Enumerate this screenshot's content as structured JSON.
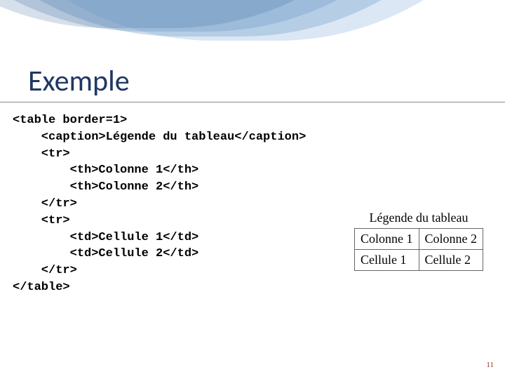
{
  "slide": {
    "title": "Exemple",
    "pageNumber": "11"
  },
  "code": {
    "line1": "<table border=1>",
    "line2": "    <caption>Légende du tableau</caption>",
    "line3": "    <tr>",
    "line4": "        <th>Colonne 1</th>",
    "line5": "        <th>Colonne 2</th>",
    "line6": "    </tr>",
    "line7": "    <tr>",
    "line8": "        <td>Cellule 1</td>",
    "line9": "        <td>Cellule 2</td>",
    "line10": "    </tr>",
    "line11": "</table>"
  },
  "exampleTable": {
    "caption": "Légende du tableau",
    "header1": "Colonne 1",
    "header2": "Colonne 2",
    "cell1": "Cellule 1",
    "cell2": "Cellule 2"
  }
}
